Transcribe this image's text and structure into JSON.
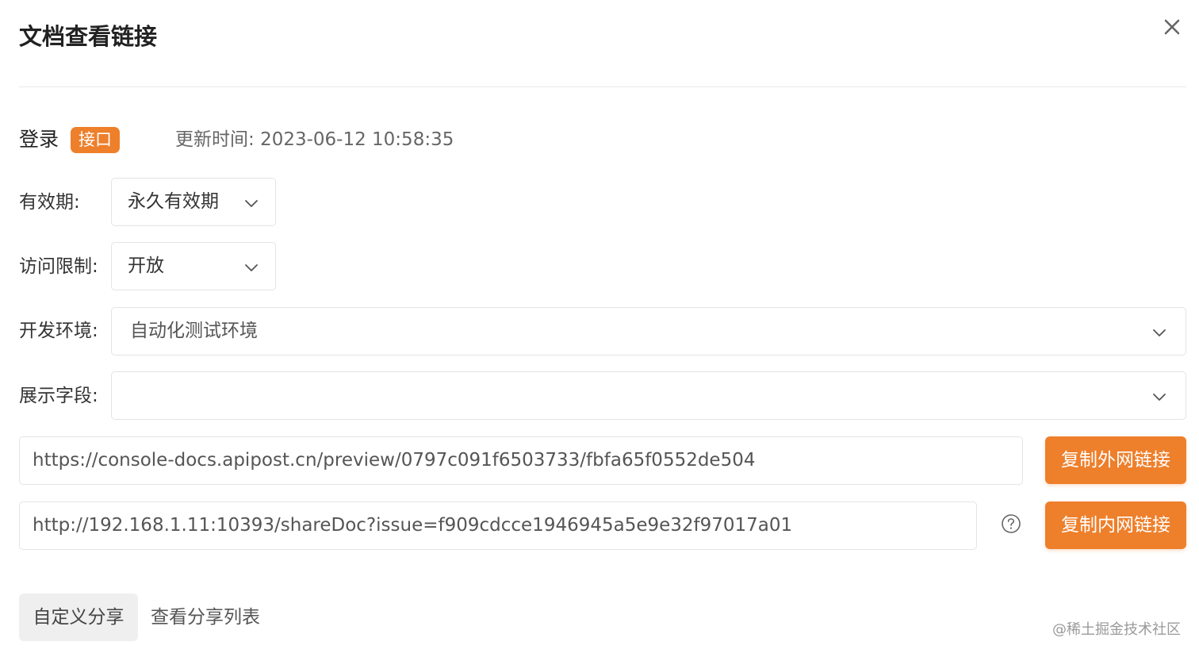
{
  "dialog": {
    "title": "文档查看链接"
  },
  "doc": {
    "name": "登录",
    "badge": "接口",
    "updated_label": "更新时间:",
    "updated_value": "2023-06-12 10:58:35"
  },
  "form": {
    "validity": {
      "label": "有效期:",
      "value": "永久有效期"
    },
    "access": {
      "label": "访问限制:",
      "value": "开放"
    },
    "env": {
      "label": "开发环境:",
      "value": "自动化测试环境"
    },
    "fields": {
      "label": "展示字段:",
      "value": ""
    }
  },
  "links": {
    "external_url": "https://console-docs.apipost.cn/preview/0797c091f6503733/fbfa65f0552de504",
    "external_button": "复制外网链接",
    "internal_url": "http://192.168.1.11:10393/shareDoc?issue=f909cdcce1946945a5e9e32f97017a01",
    "internal_button": "复制内网链接"
  },
  "tabs": {
    "custom_share": "自定义分享",
    "share_list": "查看分享列表"
  },
  "watermark": "@稀土掘金技术社区",
  "colors": {
    "accent": "#ee7f2b"
  }
}
